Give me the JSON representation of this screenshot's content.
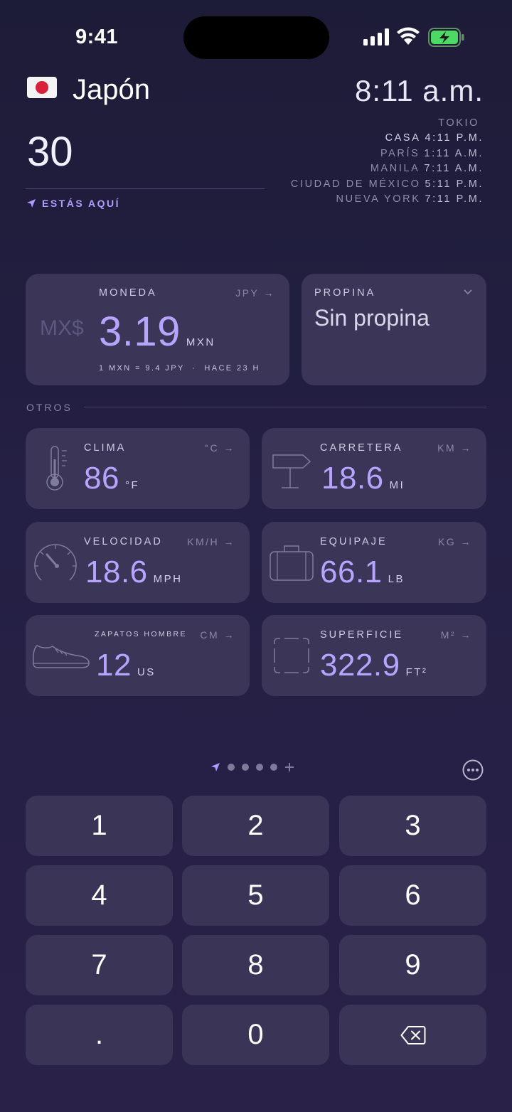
{
  "status_bar": {
    "time": "9:41"
  },
  "header": {
    "country": "Japón",
    "amount": "30",
    "here_label": "ESTÁS AQUÍ",
    "local_time": "8:11 a.m."
  },
  "time_zones": [
    {
      "city": "TOKIO",
      "time": ""
    },
    {
      "city": "CASA",
      "time": "4:11 P.M."
    },
    {
      "city": "PARÍS",
      "time": "1:11 A.M."
    },
    {
      "city": "MANILA",
      "time": "7:11 A.M."
    },
    {
      "city": "CIUDAD DE MÉXICO",
      "time": "5:11 P.M."
    },
    {
      "city": "NUEVA YORK",
      "time": "7:11 P.M."
    }
  ],
  "currency": {
    "label": "MONEDA",
    "unit": "JPY →",
    "symbol": "MX$",
    "value": "3.19",
    "value_unit": "MXN",
    "rate": "1 MXN = 9.4 JPY  ·  HACE 23 H"
  },
  "tip": {
    "label": "PROPINA",
    "value": "Sin propina"
  },
  "others_label": "OTROS",
  "conversions": [
    {
      "label": "CLIMA",
      "unit": "°C →",
      "value": "86",
      "value_unit": "°F"
    },
    {
      "label": "CARRETERA",
      "unit": "KM →",
      "value": "18.6",
      "value_unit": "MI"
    },
    {
      "label": "VELOCIDAD",
      "unit": "KM/H →",
      "value": "18.6",
      "value_unit": "MPH"
    },
    {
      "label": "EQUIPAJE",
      "unit": "KG →",
      "value": "66.1",
      "value_unit": "LB"
    },
    {
      "label": "ZAPATOS HOMBRE",
      "unit": "CM →",
      "value": "12",
      "value_unit": "US"
    },
    {
      "label": "SUPERFICIE",
      "unit": "M² →",
      "value": "322.9",
      "value_unit": "FT²"
    }
  ],
  "keypad": [
    "1",
    "2",
    "3",
    "4",
    "5",
    "6",
    "7",
    "8",
    "9",
    ".",
    "0"
  ],
  "colors": {
    "accent": "#b7a4ff",
    "card": "#3b3658",
    "background": "#1d1c37"
  }
}
